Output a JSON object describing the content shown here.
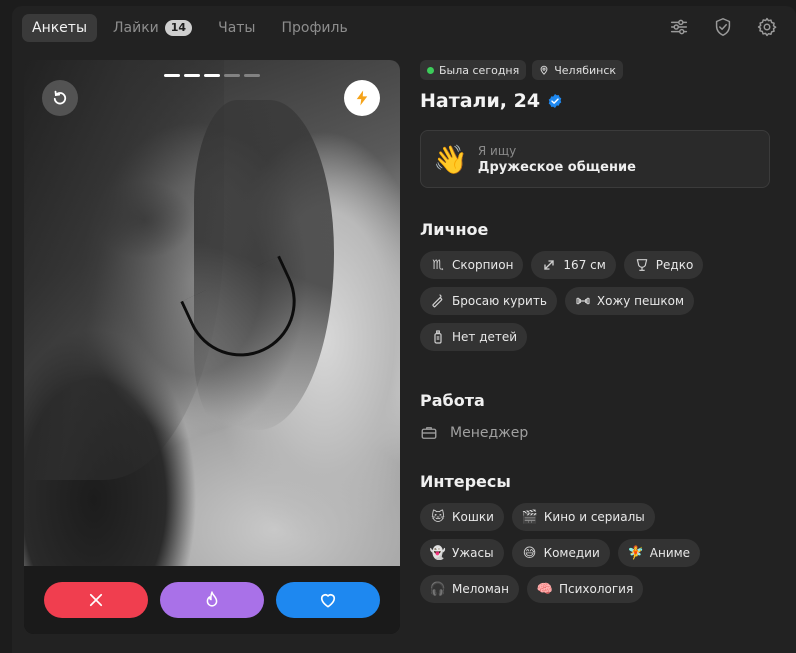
{
  "nav": {
    "tabs": [
      {
        "label": "Анкеты",
        "active": true
      },
      {
        "label": "Лайки",
        "badge": "14"
      },
      {
        "label": "Чаты"
      },
      {
        "label": "Профиль"
      }
    ]
  },
  "top_icons": [
    "filters-icon",
    "shield-check-icon",
    "gear-icon"
  ],
  "card": {
    "photo_progress": {
      "current": 3,
      "total": 5
    }
  },
  "profile": {
    "status": "Была сегодня",
    "city": "Челябинск",
    "name": "Натали, 24",
    "looking_label": "Я ищу",
    "looking_value": "Дружеское общение",
    "looking_emoji": "👋",
    "personal_title": "Личное",
    "personal": [
      {
        "label": "Скорпион",
        "icon": "scorpio-icon"
      },
      {
        "label": "167 см",
        "icon": "height-icon"
      },
      {
        "label": "Редко",
        "icon": "drink-icon"
      },
      {
        "label": "Бросаю курить",
        "icon": "smoking-icon"
      },
      {
        "label": "Хожу пешком",
        "icon": "dumbbell-icon"
      },
      {
        "label": "Нет детей",
        "icon": "baby-bottle-icon"
      }
    ],
    "work_title": "Работа",
    "work": "Менеджер",
    "interests_title": "Интересы",
    "interests": [
      {
        "label": "Кошки",
        "emoji": "🐱"
      },
      {
        "label": "Кино и сериалы",
        "emoji": "🎬"
      },
      {
        "label": "Ужасы",
        "emoji": "👻"
      },
      {
        "label": "Комедии",
        "emoji": "😅"
      },
      {
        "label": "Аниме",
        "emoji": "🧚"
      },
      {
        "label": "Меломан",
        "emoji": "🎧"
      },
      {
        "label": "Психология",
        "emoji": "🧠"
      }
    ]
  },
  "colors": {
    "dislike": "#f03e4f",
    "superlike": "#a971e8",
    "like": "#1e88f0",
    "online": "#3ccc5a",
    "verified": "#1e88f0"
  }
}
